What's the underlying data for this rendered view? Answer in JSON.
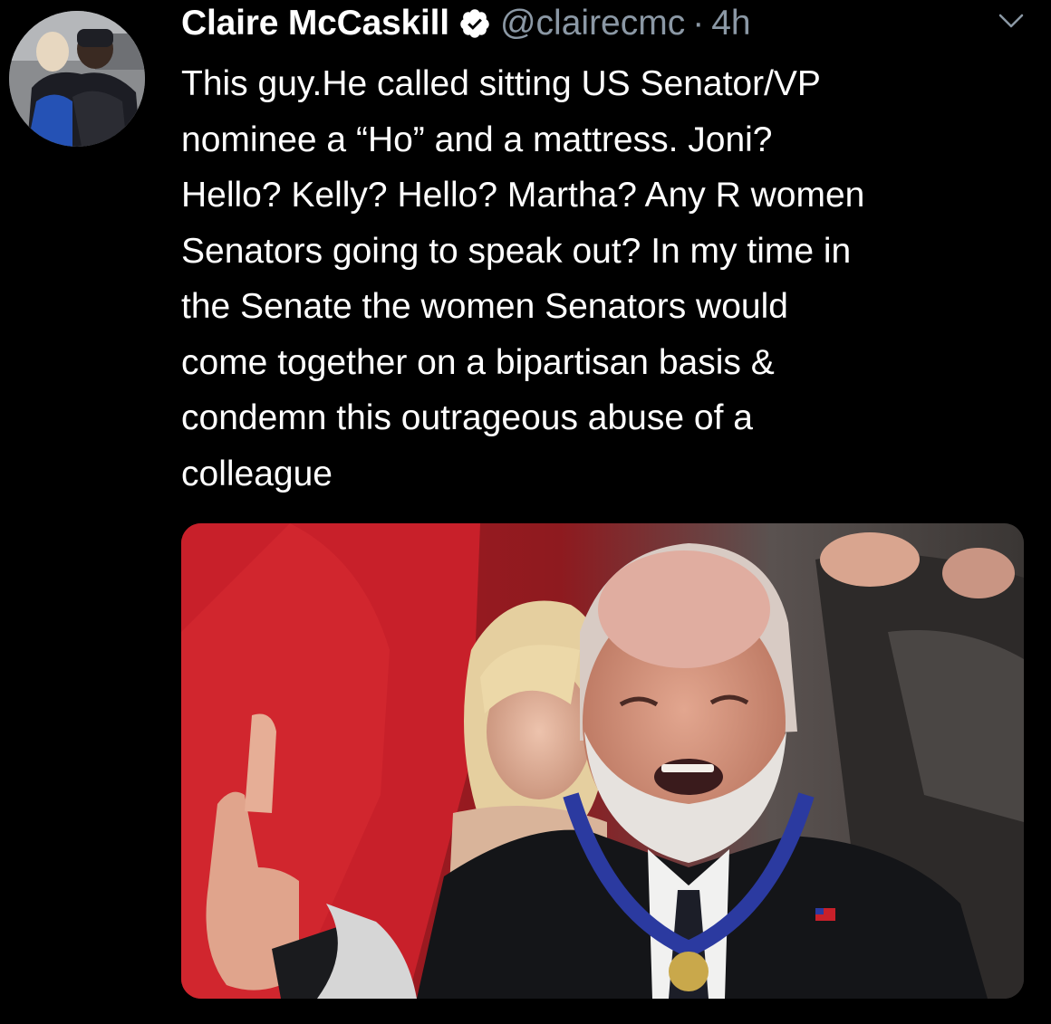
{
  "tweet": {
    "author": {
      "display_name": "Claire McCaskill",
      "handle": "@clairecmc",
      "verified": true
    },
    "separator": "·",
    "time": "4h",
    "text": "This guy.He called sitting US Senator/VP\nnominee a “Ho” and a mattress. Joni?\nHello? Kelly? Hello? Martha? Any R women\nSenators going to speak out? In my time in\nthe Senate the women Senators would\ncome together on a bipartisan basis &\ncondemn this outrageous abuse of a\ncolleague"
  },
  "icons": {
    "verified": "verified-badge-icon",
    "menu": "chevron-down-icon"
  },
  "colors": {
    "background": "#000000",
    "text_primary": "#ffffff",
    "text_secondary": "#8b98a5",
    "verified_badge": "#ffffff"
  }
}
